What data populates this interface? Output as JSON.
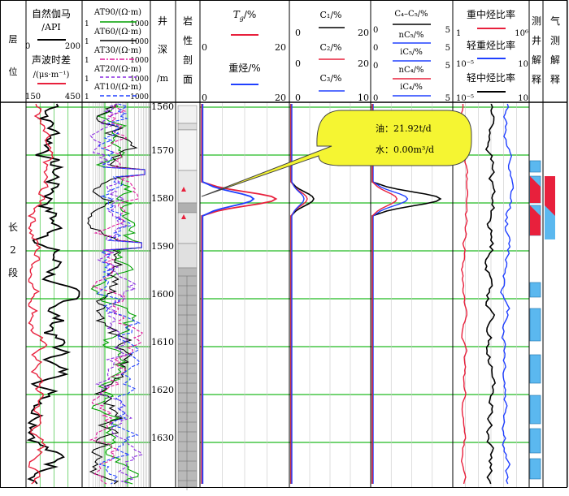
{
  "headers": {
    "layer": [
      "层",
      "位"
    ],
    "gr_title": [
      "自然伽马",
      "/API"
    ],
    "gr_range": [
      "0",
      "200"
    ],
    "ac_title": [
      "声波时差",
      "/(μs·m⁻¹)"
    ],
    "ac_range": [
      "150",
      "450"
    ],
    "res_curves": [
      {
        "label": "AT90/(Ω·m)",
        "min": "1",
        "max": "1000",
        "color": "#00a000"
      },
      {
        "label": "AT60/(Ω·m)",
        "min": "1",
        "max": "1000",
        "color": "#000000"
      },
      {
        "label": "AT30/(Ω·m)",
        "min": "1",
        "max": "1000",
        "color": "#e0189a"
      },
      {
        "label": "AT20/(Ω·m)",
        "min": "1",
        "max": "1000",
        "color": "#8a2be2"
      },
      {
        "label": "AT10/(Ω·m)",
        "min": "1",
        "max": "1000",
        "color": "#2040ff"
      }
    ],
    "depth": [
      "井",
      "深",
      "/m"
    ],
    "lith": [
      "岩",
      "性",
      "剖",
      "面"
    ],
    "tg_title": "T",
    "tg_sub": "g",
    "tg_unit": "/%",
    "tg_range": [
      "0",
      "20"
    ],
    "heavy_title": "重烃/%",
    "heavy_range": [
      "0",
      "20"
    ],
    "c1_title": "C₁/%",
    "c1_range": [
      "0",
      "20"
    ],
    "c2_title": "C₂/%",
    "c2_range": [
      "0",
      "20"
    ],
    "c3_title": "C₃/%",
    "c3_range": [
      "0",
      "10"
    ],
    "c45_title": "C₄–C₅/%",
    "c45_items": [
      "nC₅/%",
      "iC₅/%",
      "nC₄/%",
      "iC₄/%"
    ],
    "c45_range": [
      "0",
      "5"
    ],
    "ratio1_title": "重中烃比率",
    "ratio1_range": [
      "1",
      "10⁶"
    ],
    "ratio2_title": "轻重烃比率",
    "ratio2_range": [
      "10⁻⁵",
      "10"
    ],
    "ratio3_title": "轻中烃比率",
    "ratio3_range": [
      "10⁻⁵",
      "10"
    ],
    "interp": [
      "测",
      "井",
      "解",
      "释"
    ],
    "gas_interp": [
      "气",
      "测",
      "解",
      "释"
    ]
  },
  "depth_ticks": [
    "1560",
    "1570",
    "1580",
    "1590",
    "1600",
    "1610",
    "1620",
    "1630"
  ],
  "layer_name": [
    "长",
    "2",
    "段"
  ],
  "callout": {
    "oil": "油：21.92t/d",
    "water": "水：0.00m³/d"
  }
}
